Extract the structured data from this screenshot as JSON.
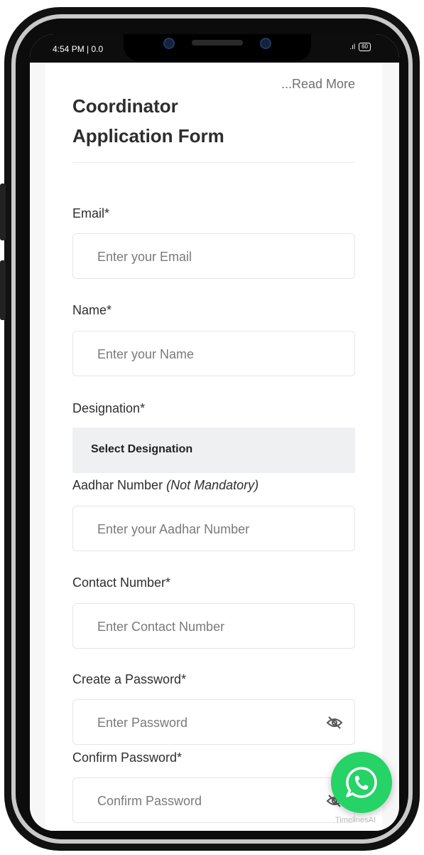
{
  "status_bar": {
    "time": "4:54 PM | 0.0",
    "signal": ".ıl",
    "battery": "60"
  },
  "header": {
    "read_more": "...Read More",
    "title": "Coordinator Application Form"
  },
  "form": {
    "email": {
      "label": "Email*",
      "placeholder": "Enter your Email"
    },
    "name": {
      "label": "Name*",
      "placeholder": "Enter your Name"
    },
    "designation": {
      "label": "Designation*",
      "value": "Select Designation"
    },
    "aadhar": {
      "label": "Aadhar Number",
      "label_note": "(Not Mandatory)",
      "placeholder": "Enter your Aadhar Number"
    },
    "contact": {
      "label": "Contact Number*",
      "placeholder": "Enter Contact Number"
    },
    "password": {
      "label": "Create a Password*",
      "placeholder": "Enter Password",
      "icon": "eye-off-icon"
    },
    "confirm_password": {
      "label": "Confirm Password*",
      "placeholder": "Confirm Password",
      "icon": "eye-off-icon"
    }
  },
  "whatsapp": {
    "icon": "whatsapp-icon",
    "branding": "TimelinesAI",
    "color": "#25d366"
  }
}
